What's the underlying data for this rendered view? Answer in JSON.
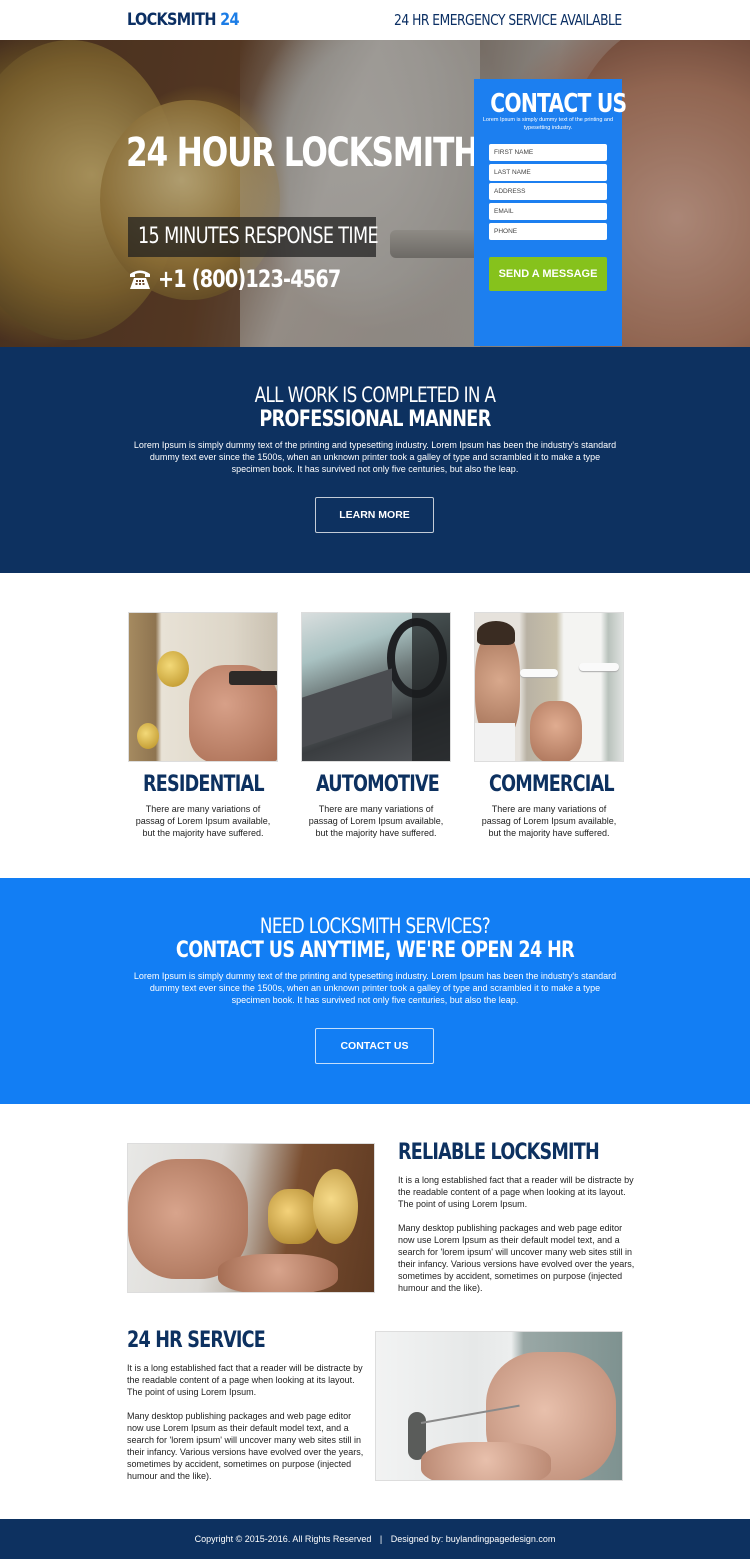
{
  "header": {
    "logo_text": "LOCKSMITH",
    "logo_accent": "24",
    "tagline": "24 HR EMERGENCY SERVICE AVAILABLE"
  },
  "hero": {
    "title": "24 HOUR LOCKSMITH",
    "subtitle": "15 MINUTES RESPONSE TIME",
    "phone_icon": "telephone-icon",
    "phone": "+1 (800)123-4567"
  },
  "contact_form": {
    "title": "CONTACT US",
    "description": "Lorem Ipsum is simply dummy text of the printing and typesetting industry.",
    "fields": [
      {
        "name": "first-name",
        "placeholder": "FIRST NAME",
        "value": ""
      },
      {
        "name": "last-name",
        "placeholder": "LAST NAME",
        "value": ""
      },
      {
        "name": "address",
        "placeholder": "ADDRESS",
        "value": ""
      },
      {
        "name": "email",
        "placeholder": "EMAIL",
        "value": ""
      },
      {
        "name": "phone",
        "placeholder": "PHONE",
        "value": ""
      }
    ],
    "submit_label": "SEND A MESSAGE"
  },
  "professional": {
    "heading_line1": "ALL WORK IS COMPLETED IN A",
    "heading_line2": "PROFESSIONAL MANNER",
    "body": "Lorem Ipsum is simply dummy text of the printing and typesetting industry. Lorem Ipsum has been the industry's standard dummy text ever since the 1500s, when an unknown printer took a galley of type and scrambled it to make a type specimen book. It has survived not only five centuries, but also the leap.",
    "button_label": "LEARN MORE"
  },
  "services": [
    {
      "title": "RESIDENTIAL",
      "text": "There are many variations of passag of Lorem Ipsum available, but the majority have suffered.",
      "image": "residential-door-lock-photo"
    },
    {
      "title": "AUTOMOTIVE",
      "text": "There are many variations of passag of Lorem Ipsum available, but the majority have suffered.",
      "image": "car-interior-photo"
    },
    {
      "title": "COMMERCIAL",
      "text": "There are many variations of passag of Lorem Ipsum available, but the majority have suffered.",
      "image": "commercial-door-lock-photo"
    }
  ],
  "cta": {
    "heading_line1": "NEED LOCKSMITH SERVICES?",
    "heading_line2": "CONTACT US ANYTIME, WE'RE OPEN 24 HR",
    "body": "Lorem Ipsum is simply dummy text of the printing and typesetting industry. Lorem Ipsum has been the industry's standard dummy text ever since the 1500s, when an unknown printer took a galley of type and scrambled it to make a type specimen book. It has survived not only five centuries, but also the leap.",
    "button_label": "CONTACT US"
  },
  "features": [
    {
      "title": "RELIABLE LOCKSMITH",
      "para1": "It is a long established fact that a reader will be distracte by the readable content of a page when looking at its layout. The point of using Lorem Ipsum.",
      "para2": "Many desktop publishing packages and web page editor now use Lorem Ipsum as their default model text, and a search for 'lorem ipsum' will uncover many web sites still in their infancy. Various versions have evolved over the years, sometimes by accident, sometimes on purpose (injected humour and the like).",
      "image": "lock-picking-doorknob-photo"
    },
    {
      "title": "24 HR SERVICE",
      "para1": "It is a long established fact that a reader will be distracte by the readable content of a page when looking at its layout. The point of using Lorem Ipsum.",
      "para2": "Many desktop publishing packages and web page editor now use Lorem Ipsum as their default model text, and a search for 'lorem ipsum' will uncover many web sites still in their infancy. Various versions have evolved over the years, sometimes by accident, sometimes on purpose (injected humour and the like).",
      "image": "lock-picking-cylinder-photo"
    }
  ],
  "footer": {
    "copyright": "Copyright © 2015-2016. All Rights Reserved",
    "separator": "|",
    "designed_by": "Designed by: buylandingpagedesign.com"
  },
  "colors": {
    "navy": "#0d3160",
    "brand_blue": "#127ef4",
    "form_blue": "#1c7ff0",
    "send_green": "#86c21c"
  }
}
